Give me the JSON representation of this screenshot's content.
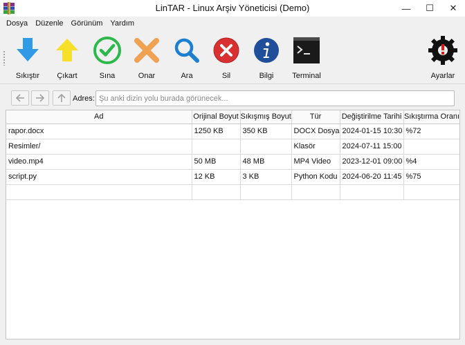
{
  "window": {
    "title": "LinTAR - Linux Arşiv Yöneticisi (Demo)",
    "minimize": "—",
    "maximize": "☐",
    "close": "✕"
  },
  "menu": {
    "items": [
      "Dosya",
      "Düzenle",
      "Görünüm",
      "Yardım"
    ]
  },
  "toolbar": {
    "compress": "Sıkıştır",
    "extract": "Çıkart",
    "test": "Sına",
    "repair": "Onar",
    "search": "Ara",
    "delete": "Sil",
    "info": "Bilgi",
    "terminal": "Terminal",
    "settings": "Ayarlar"
  },
  "address": {
    "label": "Adres:",
    "placeholder": "Şu anki dizin yolu burada görünecek...",
    "value": ""
  },
  "table": {
    "columns": [
      "Ad",
      "Orijinal Boyut",
      "Sıkışmış Boyut",
      "Tür",
      "Değiştirilme Tarihi",
      "Sıkıştırma Oranı"
    ],
    "rows": [
      [
        "rapor.docx",
        "1250 KB",
        "350 KB",
        "DOCX Dosyası",
        "2024-01-15 10:30",
        "%72"
      ],
      [
        "Resimler/",
        "",
        "",
        "Klasör",
        "2024-07-11 15:00",
        ""
      ],
      [
        "video.mp4",
        "50 MB",
        "48 MB",
        "MP4 Video",
        "2023-12-01 09:00",
        "%4"
      ],
      [
        "script.py",
        "12 KB",
        "3 KB",
        "Python Kodu",
        "2024-06-20 11:45",
        "%75"
      ]
    ]
  },
  "colors": {
    "compress_arrow": "#2f9be6",
    "extract_arrow": "#f7e02a",
    "test_check": "#2db84b",
    "repair_x": "#f0a152",
    "search_glass": "#1d7fd0",
    "delete_circle": "#d93131",
    "info_circle": "#1f4e9a"
  }
}
